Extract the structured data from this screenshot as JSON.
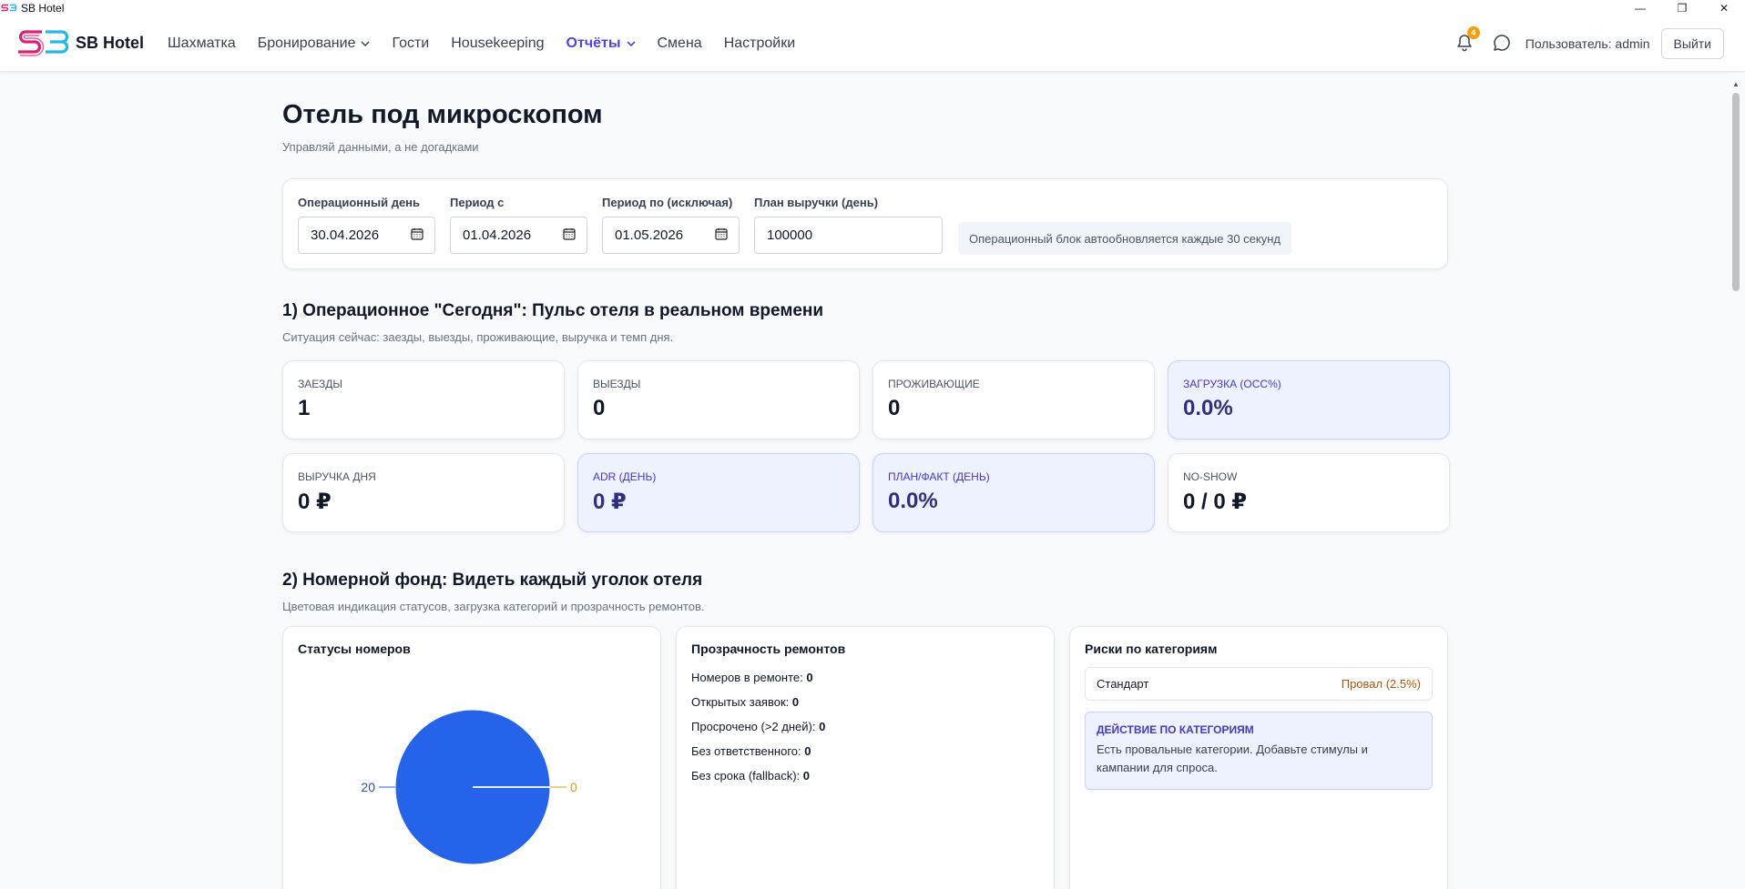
{
  "window": {
    "title": "SB Hotel",
    "controls": [
      "—",
      "❐",
      "✕"
    ]
  },
  "nav": {
    "brand": "SB Hotel",
    "items": [
      {
        "label": "Шахматка",
        "dropdown": false,
        "active": false
      },
      {
        "label": "Бронирование",
        "dropdown": true,
        "active": false
      },
      {
        "label": "Гости",
        "dropdown": false,
        "active": false
      },
      {
        "label": "Housekeeping",
        "dropdown": false,
        "active": false
      },
      {
        "label": "Отчёты",
        "dropdown": true,
        "active": true
      },
      {
        "label": "Смена",
        "dropdown": false,
        "active": false
      },
      {
        "label": "Настройки",
        "dropdown": false,
        "active": false
      }
    ],
    "notifications_count": "4",
    "user_label": "Пользователь: admin",
    "logout_label": "Выйти"
  },
  "page": {
    "title": "Отель под микроскопом",
    "subtitle": "Управляй данными, а не догадками"
  },
  "filters": {
    "op_day_label": "Операционный день",
    "op_day_value": "30.04.2026",
    "period_from_label": "Период с",
    "period_from_value": "01.04.2026",
    "period_to_label": "Период по (исключая)",
    "period_to_value": "01.05.2026",
    "revenue_plan_label": "План выручки (день)",
    "revenue_plan_value": "100000",
    "autorefresh_note": "Операционный блок автообновляется каждые 30 секунд"
  },
  "section1": {
    "title": "1) Операционное \"Сегодня\": Пульс отеля в реальном времени",
    "subtitle": "Ситуация сейчас: заезды, выезды, проживающие, выручка и темп дня.",
    "kpis": [
      {
        "label": "Заезды",
        "value": "1",
        "highlight": false
      },
      {
        "label": "Выезды",
        "value": "0",
        "highlight": false
      },
      {
        "label": "Проживающие",
        "value": "0",
        "highlight": false
      },
      {
        "label": "Загрузка (OCC%)",
        "value": "0.0%",
        "highlight": true
      },
      {
        "label": "Выручка дня",
        "value": "0 ₽",
        "highlight": false
      },
      {
        "label": "ADR (день)",
        "value": "0 ₽",
        "highlight": true
      },
      {
        "label": "План/Факт (день)",
        "value": "0.0%",
        "highlight": true
      },
      {
        "label": "No-show",
        "value": "0 / 0 ₽",
        "highlight": false
      }
    ]
  },
  "section2": {
    "title": "2) Номерной фонд: Видеть каждый уголок отеля",
    "subtitle": "Цветовая индикация статусов, загрузка категорий и прозрачность ремонтов.",
    "room_status": {
      "title": "Статусы номеров"
    },
    "repairs": {
      "title": "Прозрачность ремонтов",
      "lines": [
        {
          "label": "Номеров в ремонте:",
          "value": "0"
        },
        {
          "label": "Открытых заявок:",
          "value": "0"
        },
        {
          "label": "Просрочено (>2 дней):",
          "value": "0"
        },
        {
          "label": "Без ответственного:",
          "value": "0"
        },
        {
          "label": "Без срока (fallback):",
          "value": "0"
        }
      ]
    },
    "risks": {
      "title": "Риски по категориям",
      "rows": [
        {
          "category": "Стандарт",
          "status": "Провал (2.5%)"
        }
      ],
      "action_title": "Действие по категориям",
      "action_text": "Есть провальные категории. Добавьте стимулы и кампании для спроса."
    }
  },
  "colors": {
    "accent": "#4f46e5",
    "pie_primary": "#2563eb",
    "pie_secondary": "#d4a017",
    "badge": "#f59e0b",
    "risk_fail": "#b45309"
  },
  "chart_data": {
    "type": "pie",
    "values": [
      20,
      0
    ],
    "value_labels": [
      "20",
      "0"
    ],
    "colors": [
      "#2563eb",
      "#d4a017"
    ]
  }
}
